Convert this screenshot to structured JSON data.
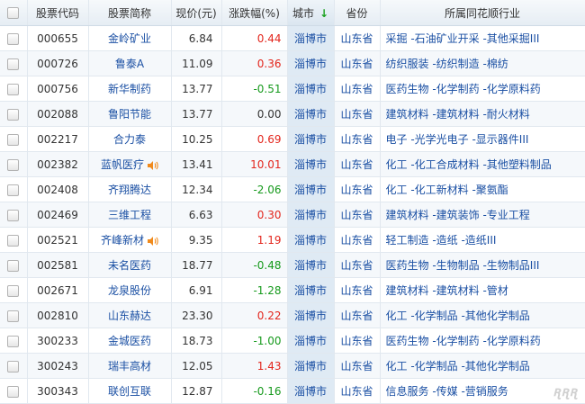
{
  "header": {
    "code": "股票代码",
    "name": "股票简称",
    "price": "现价(元)",
    "change": "涨跌幅(%)",
    "city": "城市",
    "province": "省份",
    "industry": "所属同花顺行业"
  },
  "rows": [
    {
      "code": "000655",
      "name": "金岭矿业",
      "price": "6.84",
      "change": "0.44",
      "dir": "up",
      "city": "淄博市",
      "province": "山东省",
      "industry": "采掘 -石油矿业开采 -其他采掘III",
      "speaker": false
    },
    {
      "code": "000726",
      "name": "鲁泰A",
      "price": "11.09",
      "change": "0.36",
      "dir": "up",
      "city": "淄博市",
      "province": "山东省",
      "industry": "纺织服装 -纺织制造 -棉纺",
      "speaker": false
    },
    {
      "code": "000756",
      "name": "新华制药",
      "price": "13.77",
      "change": "-0.51",
      "dir": "down",
      "city": "淄博市",
      "province": "山东省",
      "industry": "医药生物 -化学制药 -化学原料药",
      "speaker": false
    },
    {
      "code": "002088",
      "name": "鲁阳节能",
      "price": "13.77",
      "change": "0.00",
      "dir": "flat",
      "city": "淄博市",
      "province": "山东省",
      "industry": "建筑材料 -建筑材料 -耐火材料",
      "speaker": false
    },
    {
      "code": "002217",
      "name": "合力泰",
      "price": "10.25",
      "change": "0.69",
      "dir": "up",
      "city": "淄博市",
      "province": "山东省",
      "industry": "电子 -光学光电子 -显示器件III",
      "speaker": false
    },
    {
      "code": "002382",
      "name": "蓝帆医疗",
      "price": "13.41",
      "change": "10.01",
      "dir": "up",
      "city": "淄博市",
      "province": "山东省",
      "industry": "化工 -化工合成材料 -其他塑料制品",
      "speaker": true
    },
    {
      "code": "002408",
      "name": "齐翔腾达",
      "price": "12.34",
      "change": "-2.06",
      "dir": "down",
      "city": "淄博市",
      "province": "山东省",
      "industry": "化工 -化工新材料 -聚氨酯",
      "speaker": false
    },
    {
      "code": "002469",
      "name": "三维工程",
      "price": "6.63",
      "change": "0.30",
      "dir": "up",
      "city": "淄博市",
      "province": "山东省",
      "industry": "建筑材料 -建筑装饰 -专业工程",
      "speaker": false
    },
    {
      "code": "002521",
      "name": "齐峰新材",
      "price": "9.35",
      "change": "1.19",
      "dir": "up",
      "city": "淄博市",
      "province": "山东省",
      "industry": "轻工制造 -造纸 -造纸III",
      "speaker": true
    },
    {
      "code": "002581",
      "name": "未名医药",
      "price": "18.77",
      "change": "-0.48",
      "dir": "down",
      "city": "淄博市",
      "province": "山东省",
      "industry": "医药生物 -生物制品 -生物制品III",
      "speaker": false
    },
    {
      "code": "002671",
      "name": "龙泉股份",
      "price": "6.91",
      "change": "-1.28",
      "dir": "down",
      "city": "淄博市",
      "province": "山东省",
      "industry": "建筑材料 -建筑材料 -管材",
      "speaker": false
    },
    {
      "code": "002810",
      "name": "山东赫达",
      "price": "23.30",
      "change": "0.22",
      "dir": "up",
      "city": "淄博市",
      "province": "山东省",
      "industry": "化工 -化学制品 -其他化学制品",
      "speaker": false
    },
    {
      "code": "300233",
      "name": "金城医药",
      "price": "18.73",
      "change": "-1.00",
      "dir": "down",
      "city": "淄博市",
      "province": "山东省",
      "industry": "医药生物 -化学制药 -化学原料药",
      "speaker": false
    },
    {
      "code": "300243",
      "name": "瑞丰高材",
      "price": "12.05",
      "change": "1.43",
      "dir": "up",
      "city": "淄博市",
      "province": "山东省",
      "industry": "化工 -化学制品 -其他化学制品",
      "speaker": false
    },
    {
      "code": "300343",
      "name": "联创互联",
      "price": "12.87",
      "change": "-0.16",
      "dir": "down",
      "city": "淄博市",
      "province": "山东省",
      "industry": "信息服务 -传媒 -营销服务",
      "speaker": false
    }
  ],
  "colors": {
    "up": "#e3261d",
    "down": "#179a1d",
    "link": "#1a4fa3"
  },
  "sort": {
    "column": "city",
    "direction": "down",
    "icon": "sort-down-arrow-icon"
  }
}
